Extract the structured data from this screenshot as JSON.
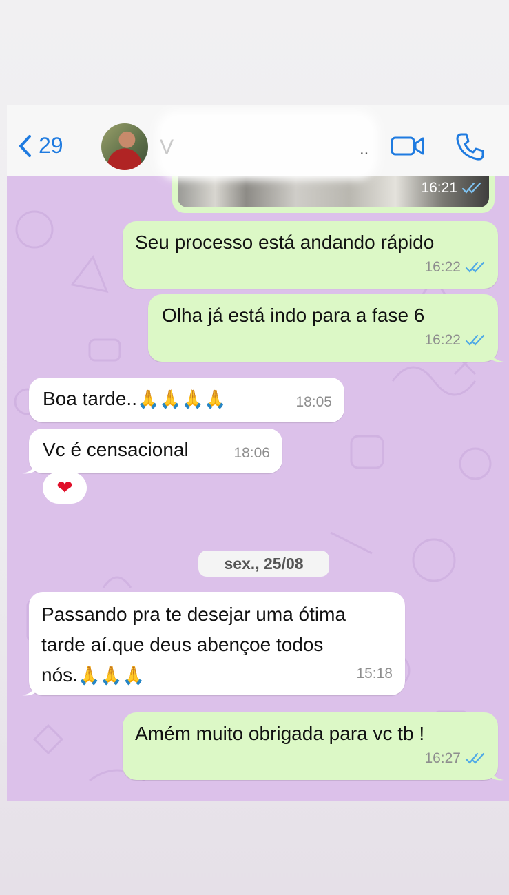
{
  "header": {
    "back_count": "29",
    "contact_initial": "V",
    "contact_truncated": ".."
  },
  "messages": [
    {
      "time": "16:21"
    },
    {
      "text": "Seu processo está andando rápido",
      "time": "16:22"
    },
    {
      "text": "Olha já está indo para a fase 6",
      "time": "16:22"
    },
    {
      "text": "Boa tarde..",
      "emoji": "🙏🙏🙏🙏",
      "time": "18:05"
    },
    {
      "text": "Vc é censacional",
      "time": "18:06",
      "reaction": "❤"
    },
    {
      "text_line1": "Passando pra te desejar uma ótima",
      "text_line2": "tarde aí.que deus abençoe todos",
      "text_line3": "nós.",
      "emoji": "🙏🙏🙏",
      "time": "15:18"
    },
    {
      "text": "Amém muito obrigada para vc tb !",
      "time": "16:27"
    }
  ],
  "date_separator": "sex., 25/08",
  "colors": {
    "accent": "#1f7be0",
    "outgoing_bubble": "#dcf8c6",
    "incoming_bubble": "#ffffff",
    "chat_background": "#dcc1ea",
    "read_ticks": "#4fa9e6"
  },
  "icons": [
    "back-chevron-icon",
    "video-call-icon",
    "phone-call-icon",
    "read-ticks-icon",
    "heart-reaction-icon",
    "pray-emoji-icon"
  ]
}
